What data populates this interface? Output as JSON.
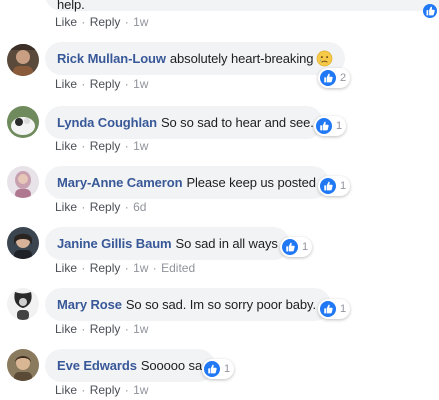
{
  "top_partial": {
    "text": "help.",
    "like": "Like",
    "reply": "Reply",
    "time": "1w"
  },
  "comments": [
    {
      "author": "Rick Mullan-Louw",
      "text": "absolutely heart-breaking",
      "emoji": "crying-face",
      "reaction_count": "2",
      "like": "Like",
      "reply": "Reply",
      "time": "1w",
      "edited": ""
    },
    {
      "author": "Lynda Coughlan",
      "text": "So so sad to hear and see.",
      "reaction_count": "1",
      "like": "Like",
      "reply": "Reply",
      "time": "1w",
      "edited": ""
    },
    {
      "author": "Mary-Anne Cameron",
      "text": "Please keep us posted",
      "reaction_count": "1",
      "like": "Like",
      "reply": "Reply",
      "time": "6d",
      "edited": ""
    },
    {
      "author": "Janine Gillis Baum",
      "text": "So sad in all ways",
      "reaction_count": "1",
      "like": "Like",
      "reply": "Reply",
      "time": "1w",
      "edited": "Edited"
    },
    {
      "author": "Mary Rose",
      "text": "So so sad. Im so sorry poor baby.",
      "reaction_count": "1",
      "like": "Like",
      "reply": "Reply",
      "time": "1w",
      "edited": ""
    },
    {
      "author": "Eve Edwards",
      "text": "Sooooo sad",
      "reaction_count": "1",
      "like": "Like",
      "reply": "Reply",
      "time": "1w",
      "edited": ""
    }
  ],
  "colors": {
    "author": "#385898",
    "bubble": "#f2f3f5",
    "like_blue": "#2078f4",
    "meta": "#90949c"
  }
}
